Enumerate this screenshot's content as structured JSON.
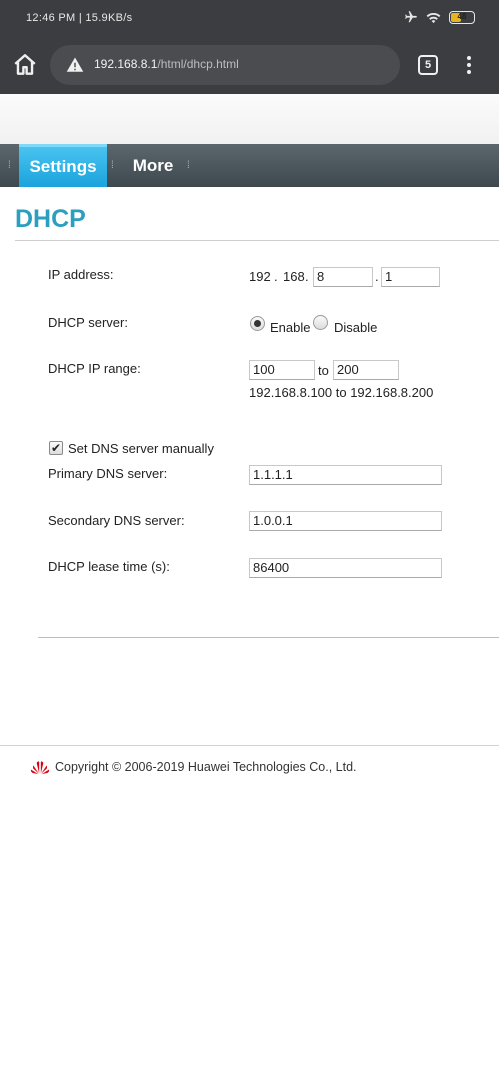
{
  "status_bar": {
    "time_speed": "12:46 PM | 15.9KB/s",
    "battery": "48"
  },
  "browser": {
    "url_host": "192.168.8.1",
    "url_path": "/html/dhcp.html",
    "tab_count": "5"
  },
  "nav": {
    "tabs": [
      {
        "label": "Settings",
        "active": true
      },
      {
        "label": "More",
        "active": false
      }
    ]
  },
  "page": {
    "title": "DHCP",
    "ip_address": {
      "label": "IP address:",
      "oct1": "192",
      "oct2": "168",
      "oct3": "8",
      "oct4": "1",
      "dot": "."
    },
    "dhcp_server": {
      "label": "DHCP server:",
      "enable_label": "Enable",
      "disable_label": "Disable",
      "selected": "Enable"
    },
    "ip_range": {
      "label": "DHCP IP range:",
      "start": "100",
      "to_label": "to",
      "end": "200",
      "summary": "192.168.8.100 to 192.168.8.200"
    },
    "dns_manual": {
      "label": "Set DNS server manually",
      "checked": true
    },
    "primary_dns": {
      "label": "Primary DNS server:",
      "value": "1.1.1.1"
    },
    "secondary_dns": {
      "label": "Secondary DNS server:",
      "value": "1.0.0.1"
    },
    "lease_time": {
      "label": "DHCP lease time (s):",
      "value": "86400"
    }
  },
  "footer": {
    "copyright": "Copyright © 2006-2019 Huawei Technologies Co., Ltd."
  },
  "colors": {
    "accent": "#2b9fbf",
    "nav_active": "#1aa3dc",
    "nav_bar": "#4a555b",
    "browser_chrome": "#3b3d40",
    "huawei_red": "#d7000f"
  }
}
